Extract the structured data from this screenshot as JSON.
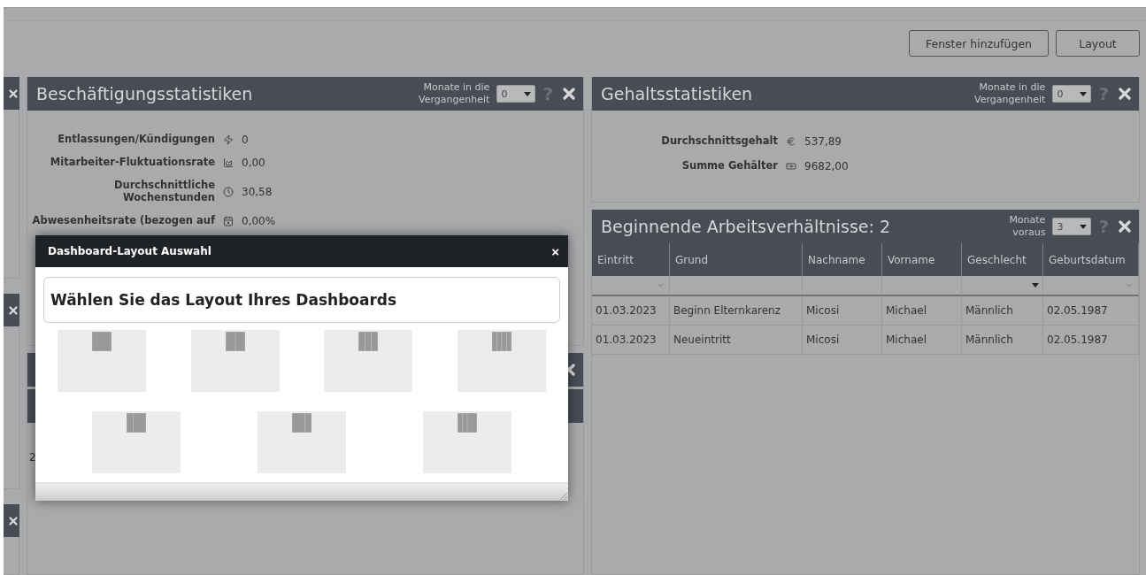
{
  "toolbar": {
    "buttons": [
      "Fenster hinzufügen",
      "Layout"
    ]
  },
  "middle_column": [
    {
      "title": "Beschäftigungsstatistiken",
      "filter_label": "Monate in die Vergangenheit",
      "filter_value": "0",
      "help": "?",
      "stats": [
        {
          "label": "Entlassungen/Kündigungen",
          "value": "0"
        },
        {
          "label": "Mitarbeiter-Fluktuationsrate",
          "value": "0,00"
        },
        {
          "label": "Durchschnittliche Wochenstunden",
          "value": "30,58"
        },
        {
          "label": "Abwesenheitsrate (bezogen auf",
          "value": "0,00%"
        }
      ]
    },
    {
      "cell": "2"
    }
  ],
  "right_column": [
    {
      "title": "Gehaltsstatistiken",
      "filter_label": "Monate in die Vergangenheit",
      "filter_value": "0",
      "help": "?",
      "stats": [
        {
          "label": "Durchschnittsgehalt",
          "value": "537,89"
        },
        {
          "label": "Summe Gehälter",
          "value": "9682,00"
        }
      ]
    },
    {
      "title": "Beginnende Arbeitsverhältnisse: 2",
      "filter_label": "Monate voraus",
      "filter_value": "3",
      "help": "?",
      "columns": [
        {
          "label": "Eintritt",
          "kind": "date"
        },
        {
          "label": "Grund",
          "kind": "text"
        },
        {
          "label": "Nachname",
          "kind": "text"
        },
        {
          "label": "Vorname",
          "kind": "text"
        },
        {
          "label": "Geschlecht",
          "kind": "select"
        },
        {
          "label": "Geburtsdatum",
          "kind": "date"
        }
      ],
      "rows": [
        [
          "01.03.2023",
          "Beginn Elternkarenz",
          "Micosi",
          "Michael",
          "Männlich",
          "02.05.1987"
        ],
        [
          "01.03.2023",
          "Neueintritt",
          "Micosi",
          "Michael",
          "Männlich",
          "02.05.1987"
        ]
      ]
    }
  ],
  "dialog": {
    "title": "Dashboard-Layout Auswahl",
    "close": "×",
    "heading": "Wählen Sie das Layout Ihres Dashboards",
    "layouts": [
      [
        {
          "kind": "single"
        },
        {
          "kind": "halves"
        },
        {
          "kind": "thirds"
        },
        {
          "kind": "quarters"
        }
      ],
      [
        {
          "kind": "narrowwide"
        },
        {
          "kind": "widenarrow"
        },
        {
          "kind": "mixed"
        }
      ]
    ]
  }
}
